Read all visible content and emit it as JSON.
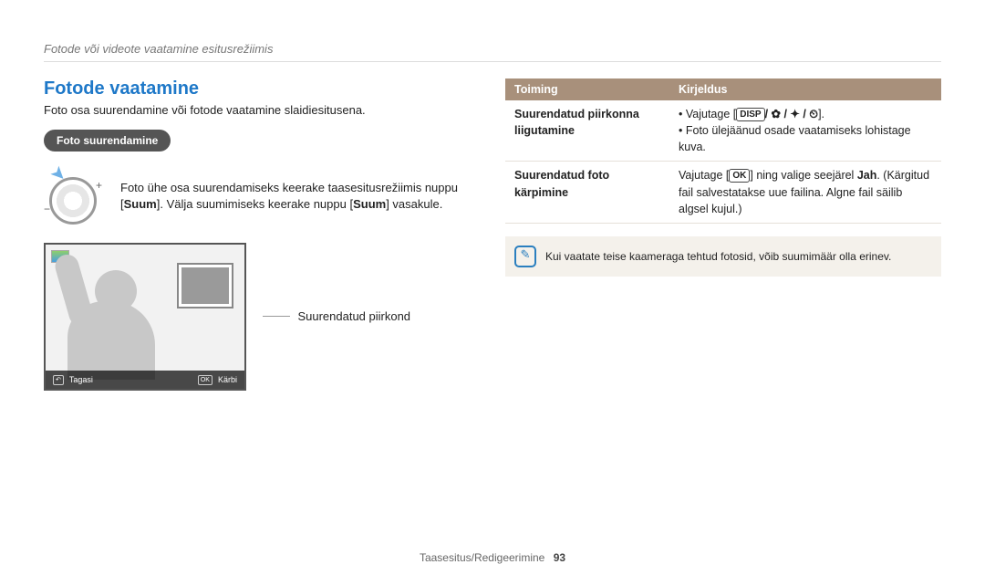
{
  "breadcrumb": "Fotode või videote vaatamine esitusrežiimis",
  "left": {
    "heading": "Fotode vaatamine",
    "lead": "Foto osa suurendamine või fotode vaatamine slaidiesitusena.",
    "pill": "Foto suurendamine",
    "instr_pre": "Foto ühe osa suurendamiseks keerake taasesitusrežiimis nuppu [",
    "instr_zoom1": "Suum",
    "instr_mid": "]. Välja suumimiseks keerake nuppu [",
    "instr_zoom2": "Suum",
    "instr_post": "] vasakule.",
    "caption": "Suurendatud piirkond",
    "bar_back_label": "Tagasi",
    "bar_ok_label": "Kärbi"
  },
  "table": {
    "col1": "Toiming",
    "col2": "Kirjeldus",
    "row1_action": "Suurendatud piirkonna liigutamine",
    "row1_desc_a": "Vajutage [",
    "row1_disp": "DISP",
    "row1_icons": "/ ✿ / ✦ / ⏲",
    "row1_desc_b": "].",
    "row1_desc_c": "Foto ülejäänud osade vaatamiseks lohistage kuva.",
    "row2_action": "Suurendatud foto kärpimine",
    "row2_a": "Vajutage [",
    "row2_ok": "OK",
    "row2_b": "] ning valige seejärel ",
    "row2_jah": "Jah",
    "row2_c": ". (Kärgitud fail salvestatakse uue failina. Algne fail säilib algsel kujul.)"
  },
  "note": "Kui vaatate teise kaameraga tehtud fotosid, võib suumimäär olla erinev.",
  "footer_section": "Taasesitus/Redigeerimine",
  "footer_page": "93"
}
